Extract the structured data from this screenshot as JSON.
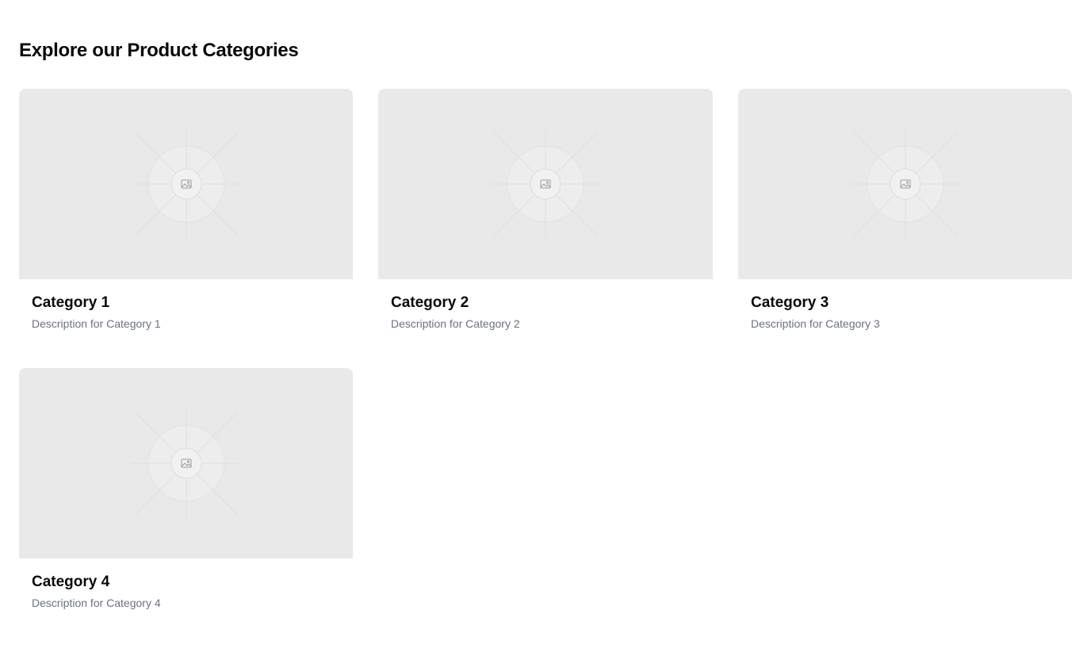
{
  "page": {
    "heading": "Explore our Product Categories"
  },
  "categories": [
    {
      "title": "Category 1",
      "description": "Description for Category 1",
      "image_icon": "image-placeholder-icon"
    },
    {
      "title": "Category 2",
      "description": "Description for Category 2",
      "image_icon": "image-placeholder-icon"
    },
    {
      "title": "Category 3",
      "description": "Description for Category 3",
      "image_icon": "image-placeholder-icon"
    },
    {
      "title": "Category 4",
      "description": "Description for Category 4",
      "image_icon": "image-placeholder-icon"
    }
  ],
  "colors": {
    "placeholder_bg": "#e9e9e9",
    "heading_text": "#0a0a0a",
    "description_text": "#6b7280"
  }
}
